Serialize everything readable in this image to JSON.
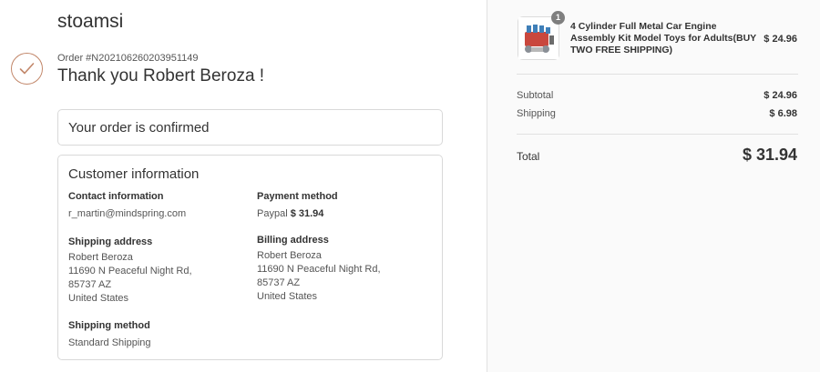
{
  "store": {
    "name": "stoamsi"
  },
  "order": {
    "number": "Order #N202106260203951149",
    "thank_you": "Thank you Robert Beroza !"
  },
  "status": {
    "confirmed": "Your order is confirmed"
  },
  "customer": {
    "title": "Customer information",
    "contact_label": "Contact information",
    "contact_email": "r_martin@mindspring.com",
    "payment_label": "Payment method",
    "payment_method": "Paypal",
    "payment_amount": "$ 31.94",
    "shipping_label": "Shipping address",
    "shipping_lines": [
      "Robert Beroza",
      "11690 N Peaceful Night Rd,",
      "85737 AZ",
      "United States"
    ],
    "billing_label": "Billing address",
    "billing_lines": [
      "Robert Beroza",
      "11690 N Peaceful Night Rd,",
      "85737 AZ",
      "United States"
    ],
    "method_label": "Shipping method",
    "method_value": "Standard Shipping"
  },
  "summary": {
    "product": {
      "quantity": "1",
      "name": "4 Cylinder Full Metal Car Engine Assembly Kit Model Toys for Adults(BUY TWO FREE SHIPPING)",
      "price": "$ 24.96"
    },
    "subtotal_label": "Subtotal",
    "subtotal_value": "$ 24.96",
    "shipping_label": "Shipping",
    "shipping_value": "$ 6.98",
    "total_label": "Total",
    "total_value": "$ 31.94"
  },
  "colors": {
    "accent": "#c2876a",
    "sidebar_bg": "#fafafa",
    "border": "#d9d9d9"
  }
}
